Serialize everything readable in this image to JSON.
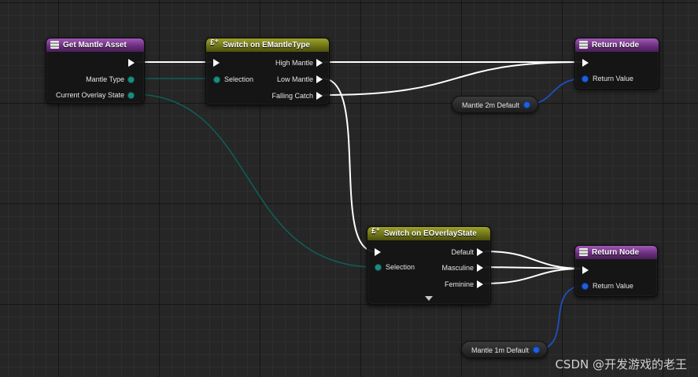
{
  "nodes": {
    "get_mantle_asset": {
      "title": "Get Mantle Asset",
      "pins": {
        "mantle_type": "Mantle Type",
        "current_overlay_state": "Current Overlay State"
      }
    },
    "switch_mantle_type": {
      "title": "Switch on EMantleType",
      "pins": {
        "selection": "Selection",
        "high_mantle": "High Mantle",
        "low_mantle": "Low Mantle",
        "falling_catch": "Falling Catch"
      }
    },
    "return_node_top": {
      "title": "Return Node",
      "pins": {
        "return_value": "Return Value"
      }
    },
    "switch_overlay_state": {
      "title": "Switch on EOverlayState",
      "pins": {
        "selection": "Selection",
        "default": "Default",
        "masculine": "Masculine",
        "feminine": "Feminine"
      }
    },
    "return_node_bottom": {
      "title": "Return Node",
      "pins": {
        "return_value": "Return Value"
      }
    },
    "mantle_2m_default": {
      "label": "Mantle 2m Default"
    },
    "mantle_1m_default": {
      "label": "Mantle 1m Default"
    }
  },
  "icons": {
    "function_node": "function-icon",
    "switch_node": "switch-enum-icon",
    "exec_pin": "exec-arrow-icon",
    "data_pin": "pin-circle-icon",
    "expand": "chevron-down-icon"
  },
  "colors": {
    "function_header": "#7a3a8e",
    "switch_header": "#7a7f1c",
    "exec_wire": "#ffffff",
    "enum_wire": "#0f5e55",
    "struct_wire": "#1f4fc0"
  },
  "watermark": "CSDN @开发游戏的老王"
}
